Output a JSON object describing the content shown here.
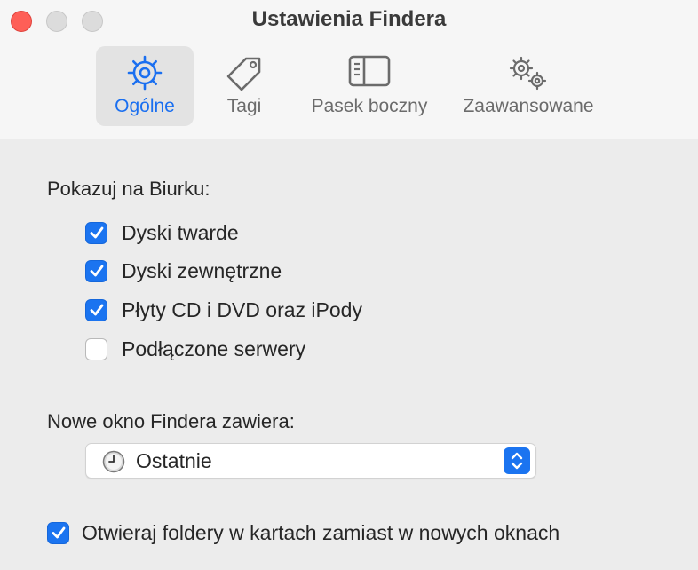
{
  "window": {
    "title": "Ustawienia Findera"
  },
  "tabs": [
    {
      "label": "Ogólne",
      "icon": "gear-icon",
      "active": true
    },
    {
      "label": "Tagi",
      "icon": "tag-icon",
      "active": false
    },
    {
      "label": "Pasek boczny",
      "icon": "sidebar-icon",
      "active": false
    },
    {
      "label": "Zaawansowane",
      "icon": "gears-icon",
      "active": false
    }
  ],
  "desktop": {
    "heading": "Pokazuj na Biurku:",
    "items": [
      {
        "label": "Dyski twarde",
        "checked": true
      },
      {
        "label": "Dyski zewnętrzne",
        "checked": true
      },
      {
        "label": "Płyty CD i DVD oraz iPody",
        "checked": true
      },
      {
        "label": "Podłączone serwery",
        "checked": false
      }
    ]
  },
  "new_window": {
    "heading": "Nowe okno Findera zawiera:",
    "selected": "Ostatnie",
    "icon": "clock-icon"
  },
  "tabs_option": {
    "label": "Otwieraj foldery w kartach zamiast w nowych oknach",
    "checked": true
  },
  "colors": {
    "accent": "#1b74f0",
    "close": "#fe5f57"
  }
}
